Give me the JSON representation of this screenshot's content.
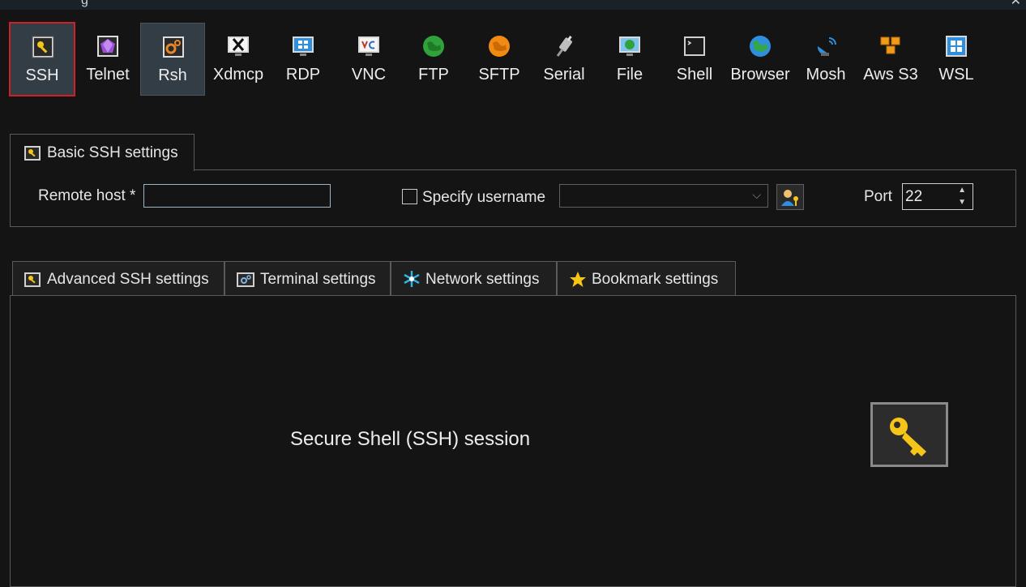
{
  "title_bar": {
    "partial_title": "g",
    "close_glyph": "✕"
  },
  "session_types": [
    {
      "label": "SSH",
      "icon": "ssh-key-icon",
      "selected": true,
      "outlined": true
    },
    {
      "label": "Telnet",
      "icon": "telnet-gem-icon"
    },
    {
      "label": "Rsh",
      "icon": "rsh-gears-icon",
      "selected": true
    },
    {
      "label": "Xdmcp",
      "icon": "xdmcp-x-icon"
    },
    {
      "label": "RDP",
      "icon": "rdp-windows-icon"
    },
    {
      "label": "VNC",
      "icon": "vnc-monitor-icon"
    },
    {
      "label": "FTP",
      "icon": "ftp-globe-icon"
    },
    {
      "label": "SFTP",
      "icon": "sftp-globe-icon"
    },
    {
      "label": "Serial",
      "icon": "serial-plug-icon"
    },
    {
      "label": "File",
      "icon": "file-globe-monitor-icon"
    },
    {
      "label": "Shell",
      "icon": "shell-terminal-icon"
    },
    {
      "label": "Browser",
      "icon": "browser-globe-icon"
    },
    {
      "label": "Mosh",
      "icon": "mosh-satellite-icon"
    },
    {
      "label": "Aws S3",
      "icon": "aws-s3-cubes-icon"
    },
    {
      "label": "WSL",
      "icon": "wsl-windows-icon"
    }
  ],
  "basic_tab": {
    "label": "Basic SSH settings"
  },
  "remote_host": {
    "label": "Remote host *",
    "value": ""
  },
  "specify_username": {
    "label": "Specify username",
    "checked": false,
    "value": ""
  },
  "port": {
    "label": "Port",
    "value": "22"
  },
  "settings_tabs": [
    {
      "label": "Advanced SSH settings",
      "icon": "wrench-key-icon"
    },
    {
      "label": "Terminal settings",
      "icon": "terminal-gears-icon"
    },
    {
      "label": "Network settings",
      "icon": "network-star-icon"
    },
    {
      "label": "Bookmark settings",
      "icon": "star-icon"
    }
  ],
  "session_description": "Secure Shell (SSH) session",
  "colors": {
    "accent_yellow": "#f5c518",
    "selected_bg": "#333d46",
    "outline_red": "#d11f26"
  }
}
